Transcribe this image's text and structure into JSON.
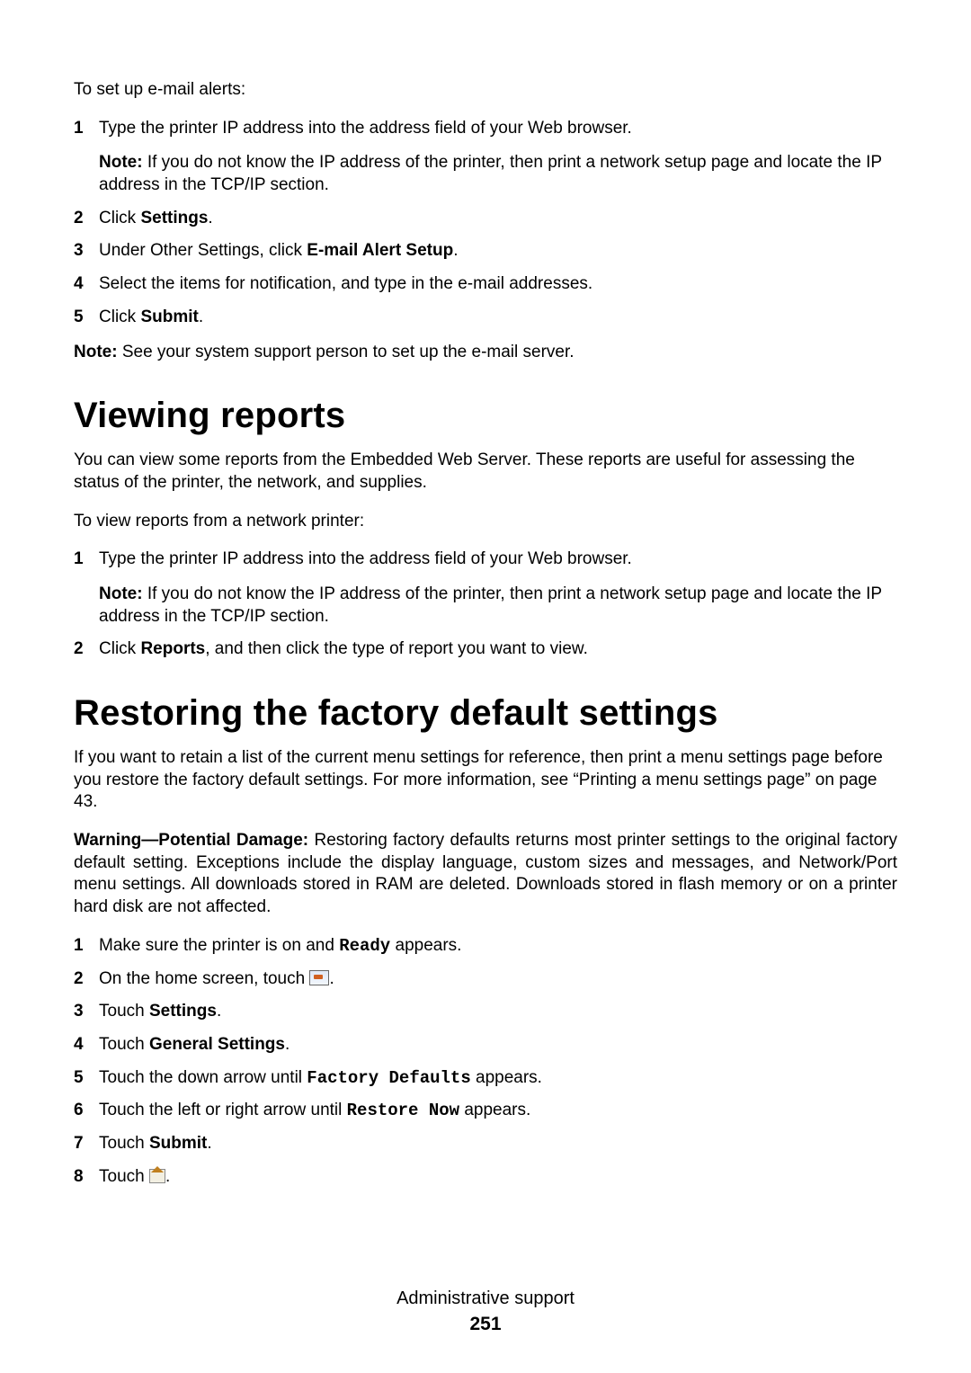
{
  "intro1": "To set up e-mail alerts:",
  "s1": {
    "steps": [
      {
        "n": "1",
        "pre": "Type the printer IP address into the address field of your Web browser.",
        "note_label": "Note:",
        "note_rest": " If you do not know the IP address of the printer, then print a network setup page and locate the IP address in the TCP/IP section."
      },
      {
        "n": "2",
        "pre": "Click ",
        "bold": "Settings",
        "post": "."
      },
      {
        "n": "3",
        "pre": "Under Other Settings, click ",
        "bold": "E-mail Alert Setup",
        "post": "."
      },
      {
        "n": "4",
        "pre": "Select the items for notification, and type in the e-mail addresses."
      },
      {
        "n": "5",
        "pre": "Click ",
        "bold": "Submit",
        "post": "."
      }
    ]
  },
  "note1_label": "Note:",
  "note1_rest": " See your system support person to set up the e-mail server.",
  "h1a": "Viewing reports",
  "p_a1": "You can view some reports from the Embedded Web Server. These reports are useful for assessing the status of the printer, the network, and supplies.",
  "p_a2": "To view reports from a network printer:",
  "s2": {
    "steps": [
      {
        "n": "1",
        "pre": "Type the printer IP address into the address field of your Web browser.",
        "note_label": "Note:",
        "note_rest": " If you do not know the IP address of the printer, then print a network setup page and locate the IP address in the TCP/IP section."
      },
      {
        "n": "2",
        "pre": "Click ",
        "bold": "Reports",
        "post": ", and then click the type of report you want to view."
      }
    ]
  },
  "h1b": "Restoring the factory default settings",
  "p_b1": "If you want to retain a list of the current menu settings for reference, then print a menu settings page before you restore the factory default settings. For more information, see “Printing a menu settings page” on page 43.",
  "warn_label": "Warning—Potential Damage:",
  "warn_rest": " Restoring factory defaults returns most printer settings to the original factory default setting. Exceptions include the display language, custom sizes and messages, and Network/Port menu settings. All downloads stored in RAM are deleted. Downloads stored in flash memory or on a printer hard disk are not affected.",
  "s3": {
    "steps": [
      {
        "n": "1",
        "pre": "Make sure the printer is on and ",
        "mono": "Ready",
        "post": " appears."
      },
      {
        "n": "2",
        "pre": "On the home screen, touch ",
        "icon": "toolbox",
        "post": "."
      },
      {
        "n": "3",
        "pre": "Touch ",
        "bold": "Settings",
        "post": "."
      },
      {
        "n": "4",
        "pre": "Touch ",
        "bold": "General Settings",
        "post": "."
      },
      {
        "n": "5",
        "pre": "Touch the down arrow until ",
        "mono": "Factory Defaults",
        "post": " appears."
      },
      {
        "n": "6",
        "pre": "Touch the left or right arrow until ",
        "mono": "Restore Now",
        "post": " appears."
      },
      {
        "n": "7",
        "pre": "Touch ",
        "bold": "Submit",
        "post": "."
      },
      {
        "n": "8",
        "pre": "Touch ",
        "icon": "home",
        "post": "."
      }
    ]
  },
  "footer_title": "Administrative support",
  "footer_page": "251"
}
